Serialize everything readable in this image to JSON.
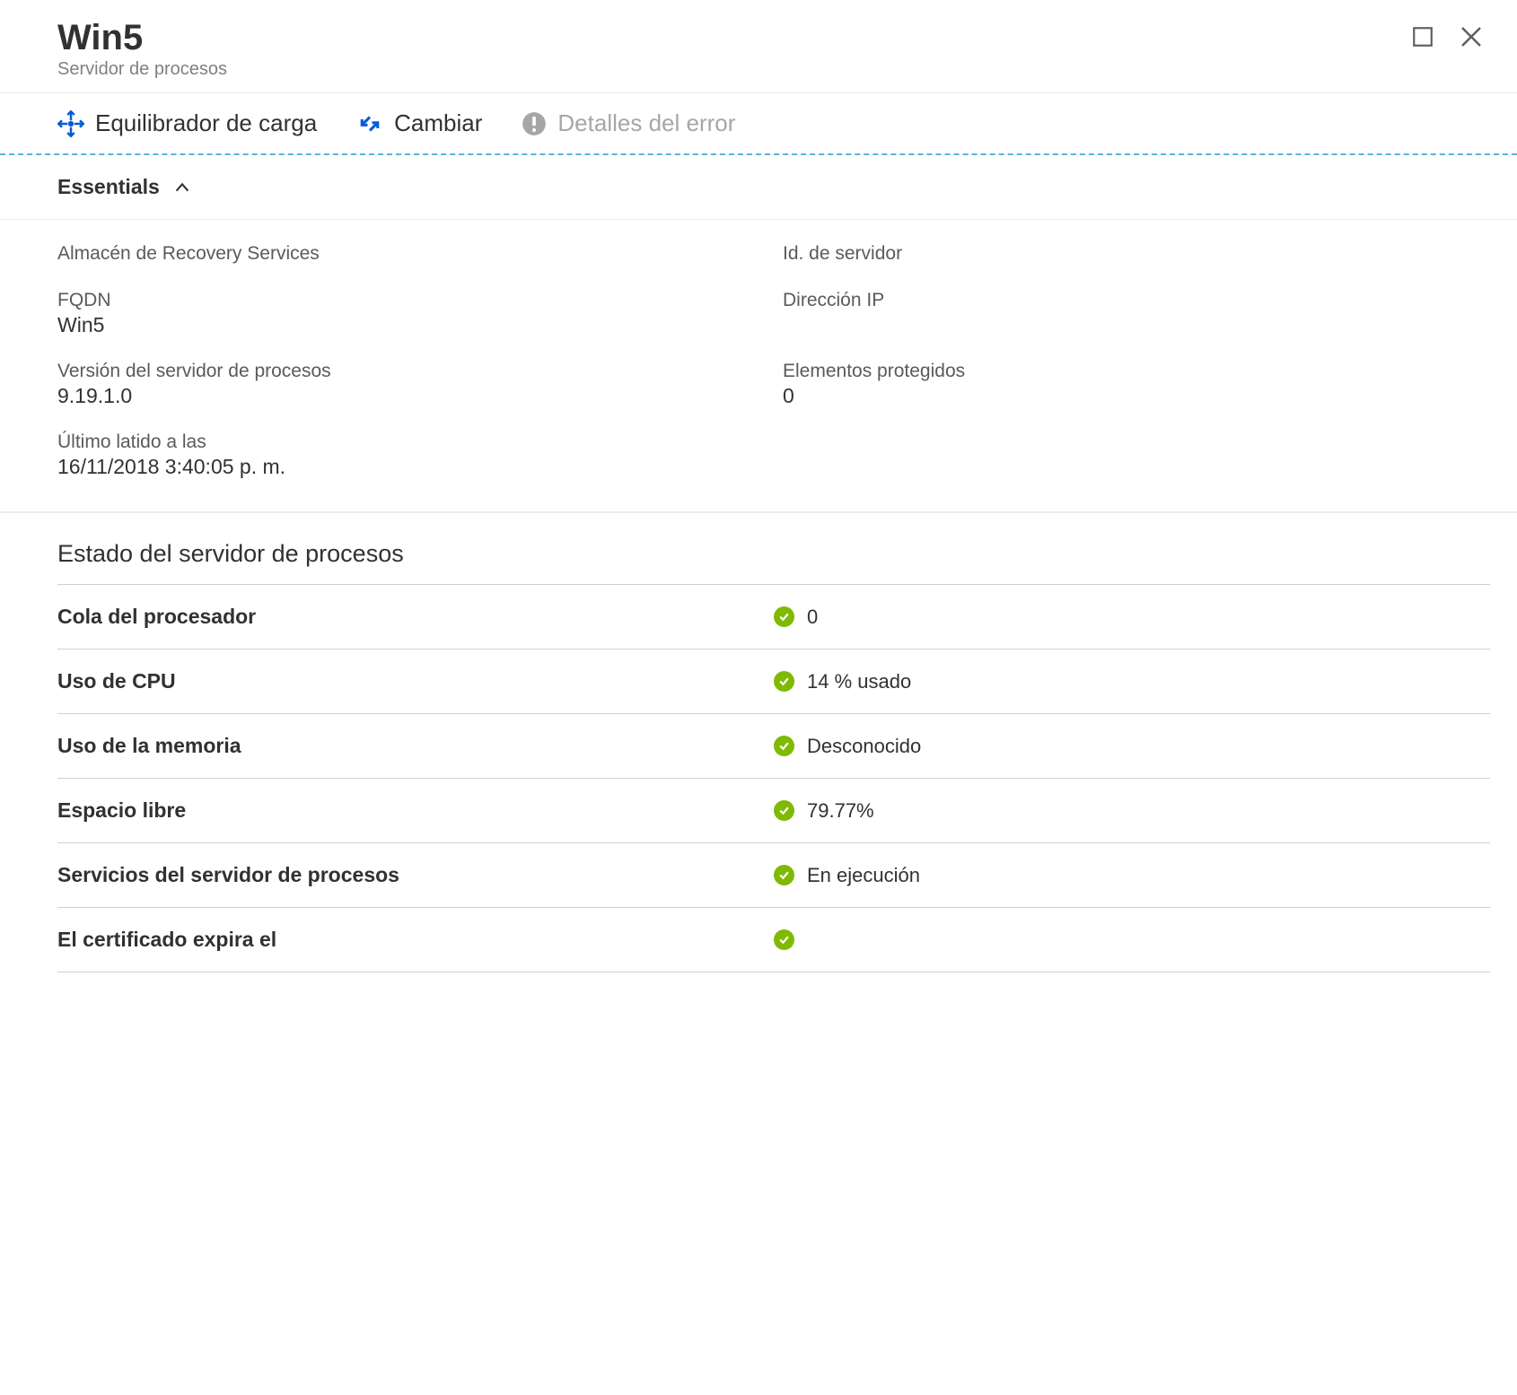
{
  "header": {
    "title": "Win5",
    "subtitle": "Servidor de procesos"
  },
  "toolbar": {
    "load_balancer": "Equilibrador de carga",
    "switch": "Cambiar",
    "error_details": "Detalles del error"
  },
  "essentials": {
    "label": "Essentials",
    "fields": {
      "recovery_vault_label": "Almacén de Recovery Services",
      "recovery_vault_value": "",
      "server_id_label": "Id. de servidor",
      "server_id_value": "",
      "fqdn_label": "FQDN",
      "fqdn_value": "Win5",
      "ip_label": "Dirección IP",
      "ip_value": "",
      "version_label": "Versión del servidor de procesos",
      "version_value": "9.19.1.0",
      "protected_items_label": "Elementos protegidos",
      "protected_items_value": "0",
      "last_heartbeat_label": "Último latido a las",
      "last_heartbeat_value": "16/11/2018 3:40:05 p. m."
    }
  },
  "status": {
    "title": "Estado del servidor de procesos",
    "rows": [
      {
        "label": "Cola del procesador",
        "value": "0"
      },
      {
        "label": "Uso de CPU",
        "value": "14 % usado"
      },
      {
        "label": "Uso de la memoria",
        "value": "Desconocido"
      },
      {
        "label": "Espacio libre",
        "value": "79.77%"
      },
      {
        "label": "Servicios del servidor de procesos",
        "value": "En ejecución"
      },
      {
        "label": "El certificado expira el",
        "value": ""
      }
    ]
  },
  "colors": {
    "accent_blue": "#015cda",
    "ok_green": "#7fba00",
    "disabled_gray": "#a6a6a6"
  }
}
